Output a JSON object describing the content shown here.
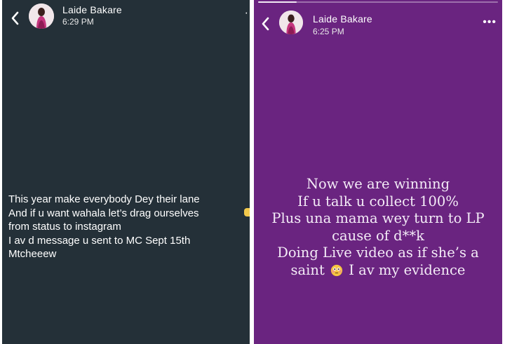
{
  "screens": [
    {
      "header": {
        "name": "Laide Bakare",
        "time": "6:29 PM"
      },
      "status": {
        "lines": [
          "This year make everybody Dey their lane",
          "And if u want wahala let’s drag ourselves",
          "from status to instagram",
          "I av d message u sent to MC Sept 15th",
          "Mtcheeew"
        ]
      },
      "colors": {
        "background": "#243038",
        "text": "#ffffff"
      }
    },
    {
      "header": {
        "name": "Laide Bakare",
        "time": "6:25 PM"
      },
      "status": {
        "lines": [
          "Now we are winning",
          "If u talk u collect 100%",
          "Plus una mama wey turn to LP",
          "cause of d**k",
          "Doing Live video as if she’s a"
        ],
        "last_line": {
          "before": "saint",
          "emoji": "flushed-face-icon",
          "after": "I av my evidence"
        }
      },
      "progress": 0.16,
      "colors": {
        "background": "#6a2480",
        "text": "#f4ecf7"
      }
    }
  ]
}
